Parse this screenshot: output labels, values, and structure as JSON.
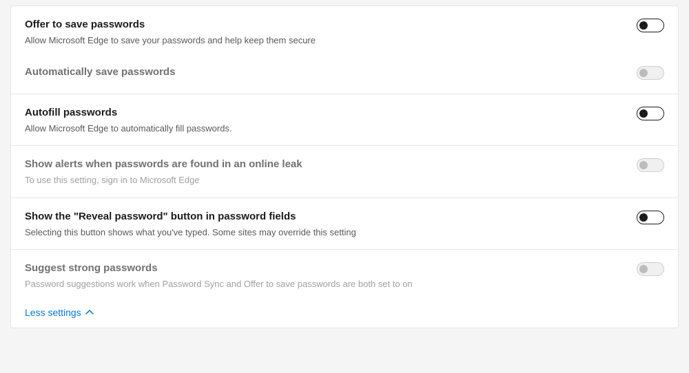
{
  "settings": {
    "offer_save": {
      "title": "Offer to save passwords",
      "desc": "Allow Microsoft Edge to save your passwords and help keep them secure"
    },
    "auto_save": {
      "title": "Automatically save passwords"
    },
    "autofill": {
      "title": "Autofill passwords",
      "desc": "Allow Microsoft Edge to automatically fill passwords."
    },
    "leak_alerts": {
      "title": "Show alerts when passwords are found in an online leak",
      "desc": "To use this setting, sign in to Microsoft Edge"
    },
    "reveal": {
      "title": "Show the \"Reveal password\" button in password fields",
      "desc": "Selecting this button shows what you've typed. Some sites may override this setting"
    },
    "suggest": {
      "title": "Suggest strong passwords",
      "desc": "Password suggestions work when Password Sync and Offer to save passwords are both set to on"
    }
  },
  "less_settings_label": "Less settings"
}
